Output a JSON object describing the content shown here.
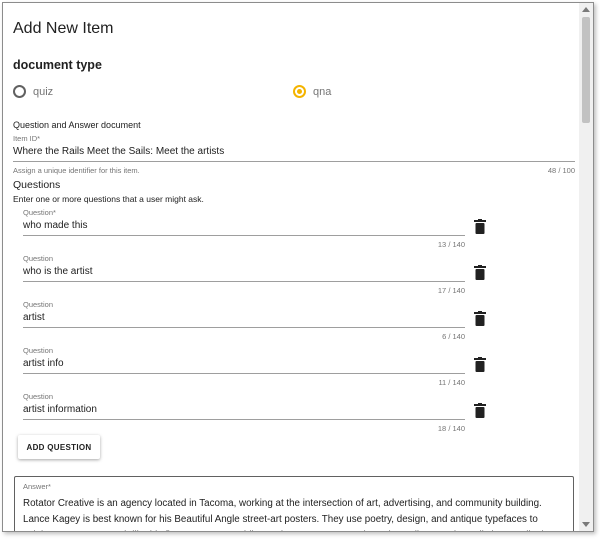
{
  "dialog": {
    "title": "Add New Item"
  },
  "document_type": {
    "title": "document type",
    "options": [
      {
        "label": "quiz",
        "selected": false
      },
      {
        "label": "qna",
        "selected": true
      }
    ],
    "accent_color": "#f4b400"
  },
  "doc": {
    "description": "Question and Answer document"
  },
  "item_id": {
    "label": "Item ID*",
    "value": "Where the Rails Meet the Sails: Meet the artists",
    "hint": "Assign a unique identifier for this item.",
    "counter": "48 / 100"
  },
  "questions": {
    "title": "Questions",
    "hint": "Enter one or more questions that a user might ask.",
    "items": [
      {
        "label": "Question*",
        "value": "who made this",
        "counter": "13 / 140"
      },
      {
        "label": "Question",
        "value": "who is the artist",
        "counter": "17 / 140"
      },
      {
        "label": "Question",
        "value": "artist",
        "counter": "6 / 140"
      },
      {
        "label": "Question",
        "value": "artist info",
        "counter": "11 / 140"
      },
      {
        "label": "Question",
        "value": "artist information",
        "counter": "18 / 140"
      }
    ],
    "delete_icon": "trash-icon",
    "add_label": "ADD QUESTION"
  },
  "answer": {
    "label": "Answer*",
    "value": "Rotator Creative is an agency located in Tacoma, working at the intersection of art, advertising, and community building. Lance Kagey is best known for his Beautiful Angle street-art posters. They use poetry, design, and antique typefaces to celebrate Tacoma, much like his first permanent public art piece. For Kagey, Where the Rails Meet the Sails is a meditation on"
  }
}
